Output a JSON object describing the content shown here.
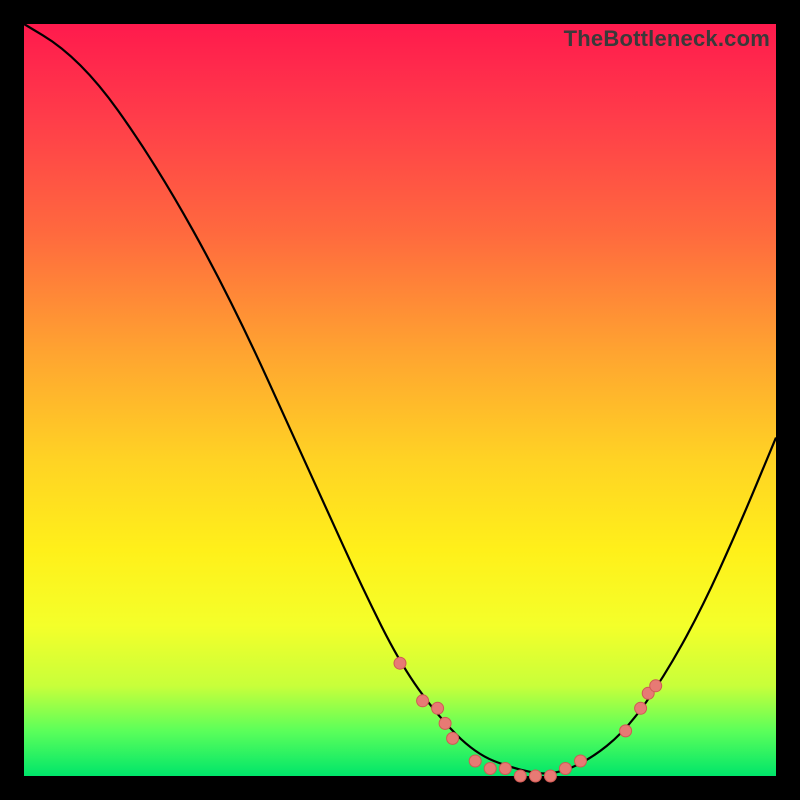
{
  "watermark": "TheBottleneck.com",
  "colors": {
    "dot_fill": "#e77a74",
    "dot_stroke": "#cf5a54",
    "curve": "#000000"
  },
  "chart_data": {
    "type": "line",
    "title": "",
    "xlabel": "",
    "ylabel": "",
    "xlim": [
      0,
      100
    ],
    "ylim": [
      0,
      100
    ],
    "grid": false,
    "legend": false,
    "series": [
      {
        "name": "bottleneck-curve",
        "x": [
          0,
          5,
          10,
          15,
          20,
          25,
          30,
          35,
          40,
          45,
          50,
          55,
          60,
          65,
          70,
          75,
          80,
          85,
          90,
          95,
          100
        ],
        "y": [
          100,
          97,
          92,
          85,
          77,
          68,
          58,
          47,
          36,
          25,
          15,
          8,
          3,
          1,
          0,
          2,
          6,
          13,
          22,
          33,
          45
        ]
      }
    ],
    "points": [
      {
        "x": 50,
        "y": 15,
        "label": ""
      },
      {
        "x": 53,
        "y": 10,
        "label": ""
      },
      {
        "x": 55,
        "y": 9,
        "label": ""
      },
      {
        "x": 56,
        "y": 7,
        "label": ""
      },
      {
        "x": 57,
        "y": 5,
        "label": ""
      },
      {
        "x": 60,
        "y": 2,
        "label": ""
      },
      {
        "x": 62,
        "y": 1,
        "label": ""
      },
      {
        "x": 64,
        "y": 1,
        "label": ""
      },
      {
        "x": 66,
        "y": 0,
        "label": ""
      },
      {
        "x": 68,
        "y": 0,
        "label": ""
      },
      {
        "x": 70,
        "y": 0,
        "label": ""
      },
      {
        "x": 72,
        "y": 1,
        "label": ""
      },
      {
        "x": 74,
        "y": 2,
        "label": ""
      },
      {
        "x": 80,
        "y": 6,
        "label": ""
      },
      {
        "x": 82,
        "y": 9,
        "label": ""
      },
      {
        "x": 83,
        "y": 11,
        "label": ""
      },
      {
        "x": 84,
        "y": 12,
        "label": ""
      }
    ]
  }
}
